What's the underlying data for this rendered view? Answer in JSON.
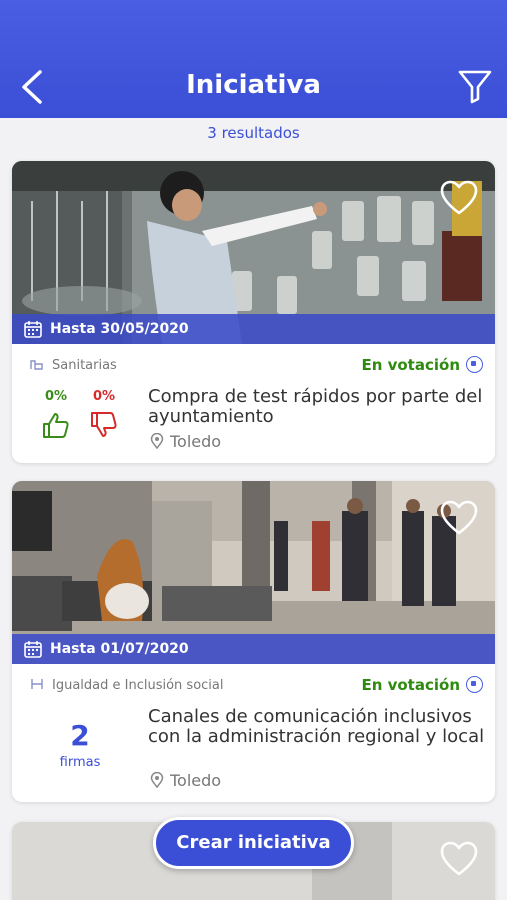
{
  "header": {
    "title": "Iniciativa",
    "back_icon": "chevron-left-icon",
    "filter_icon": "filter-icon"
  },
  "results": {
    "label": "3 resultados"
  },
  "cards": [
    {
      "deadline": "Hasta 30/05/2020",
      "category": "Sanitarias",
      "status": "En votación",
      "title": "Compra de test rápidos por parte del ayuntamiento",
      "location": "Toledo",
      "votes": {
        "positive": "0%",
        "negative": "0%"
      }
    },
    {
      "deadline": "Hasta 01/07/2020",
      "category": "Igualdad e Inclusión social",
      "status": "En votación",
      "title": "Canales de comunicación inclusivos con la administración regional y local",
      "location": "Toledo",
      "signatures": {
        "count": "2",
        "label": "firmas"
      }
    }
  ],
  "create_button": {
    "label": "Crear iniciativa"
  },
  "colors": {
    "primary": "#3b4fd6",
    "status_green": "#2e8b10",
    "negative_red": "#d62a2a"
  }
}
